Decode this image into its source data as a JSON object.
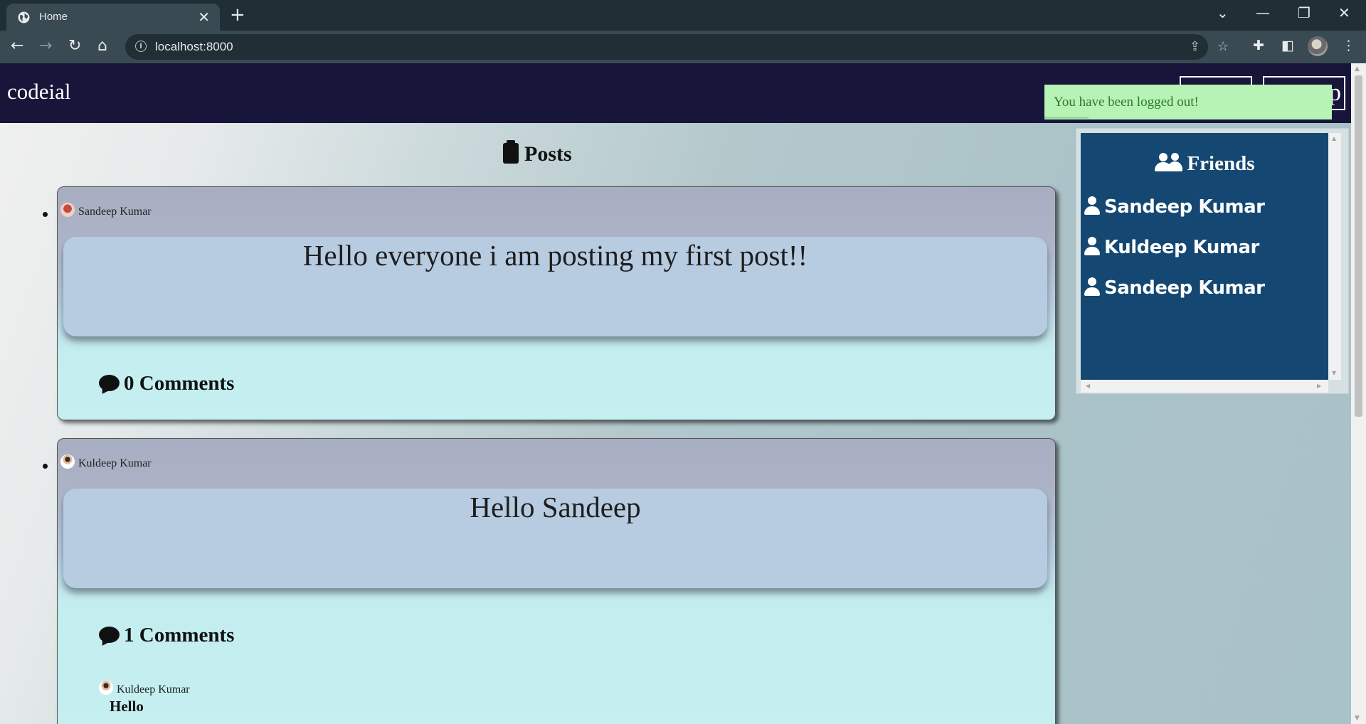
{
  "browser": {
    "tab_title": "Home",
    "tab_close": "✕",
    "new_tab": "+",
    "url": "localhost:8000",
    "controls": {
      "dropdown": "⌄",
      "minimize": "—",
      "restore": "❐",
      "close": "✕"
    }
  },
  "site": {
    "brand": "codeial",
    "header_button_1": "",
    "header_button_2": "p",
    "flash_message": "You have been logged out!"
  },
  "posts": {
    "heading": "Posts",
    "items": [
      {
        "author": "Sandeep Kumar",
        "content": "Hello everyone i am posting my first post!!",
        "comments_label": "0 Comments",
        "comments": []
      },
      {
        "author": "Kuldeep Kumar",
        "content": "Hello Sandeep",
        "comments_label": "1 Comments",
        "comments": [
          {
            "author": "Kuldeep Kumar",
            "text": "Hello"
          }
        ]
      }
    ]
  },
  "friends": {
    "title": "Friends",
    "items": [
      "Sandeep Kumar",
      "Kuldeep Kumar",
      "Sandeep Kumar"
    ]
  },
  "colors": {
    "header_bg": "#17153a",
    "flash_bg": "#b7f3b4",
    "friends_bg": "#144872",
    "post_content_bg": "#b7cbe1"
  }
}
